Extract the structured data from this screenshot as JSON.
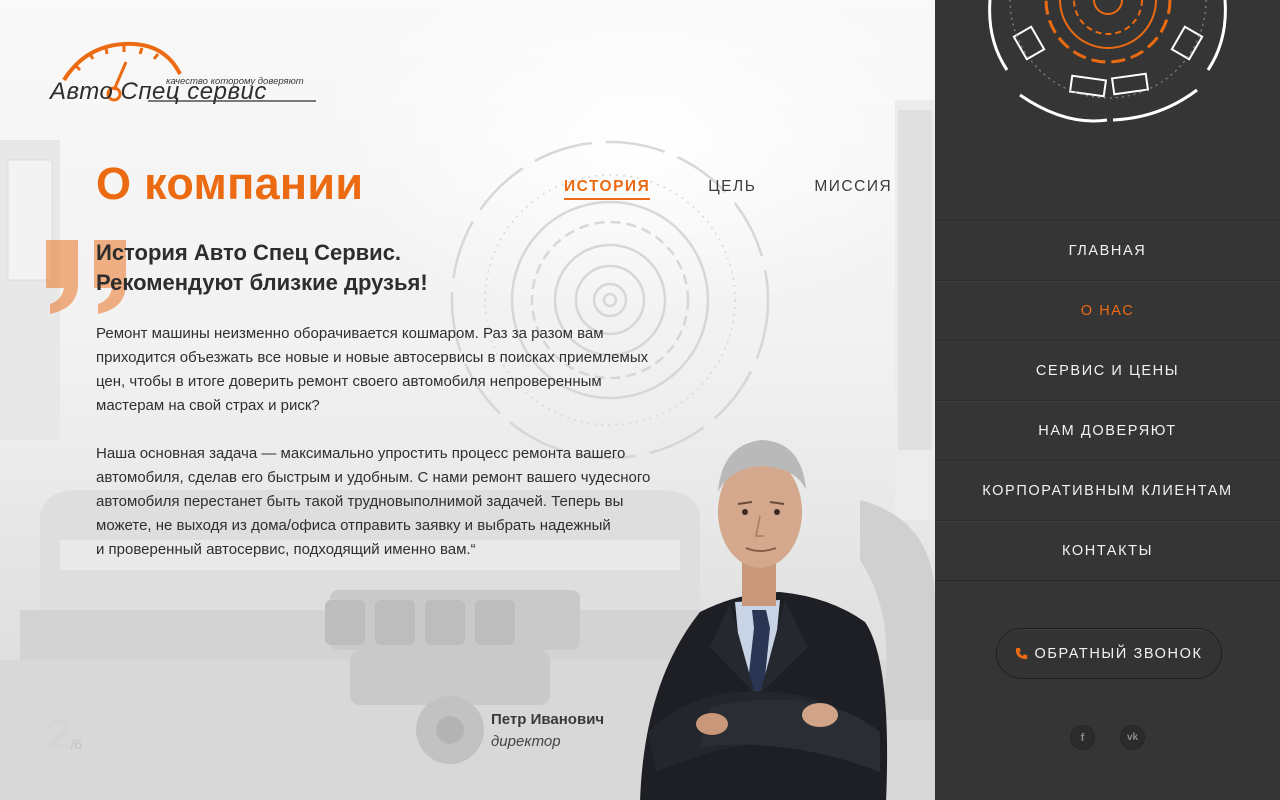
{
  "brand": {
    "title": "Авто Спец сервис",
    "slogan": "качество которому доверяют",
    "accent_color": "#ec6b12",
    "dark_color": "#353535"
  },
  "page": {
    "title": "О компании"
  },
  "tabs": [
    {
      "label": "История",
      "active": true
    },
    {
      "label": "Цель",
      "active": false
    },
    {
      "label": "Миссия",
      "active": false
    }
  ],
  "content": {
    "heading_line1": "История Авто Спец Сервис.",
    "heading_line2": "Рекомендуют близкие друзья!",
    "paragraph1": "Ремонт машины неизменно оборачивается кошмаром. Раз за разом вам\nприходится объезжать все новые и новые автосервисы в поисках приемлемых\nцен, чтобы в итоге доверить ремонт своего автомобиля непроверенным\nмастерам на свой страх и риск?",
    "paragraph2": "Наша основная задача — максимально упростить процесс ремонта вашего\nавтомобиля, сделав его быстрым и удобным. С нами ремонт вашего чудесного\nавтомобиля перестанет быть такой трудновыполнимой задачей. Теперь вы\nможете, не выходя из дома/офиса отправить заявку и выбрать надежный\nи проверенный автосервис, подходящий именно вам.“"
  },
  "signature": {
    "name": "Петр Иванович",
    "role": "директор"
  },
  "pager": {
    "current": "2",
    "separator": "/",
    "total": "6"
  },
  "nav": [
    {
      "label": "Главная",
      "active": false,
      "name": "nav-item-home"
    },
    {
      "label": "О нас",
      "active": true,
      "name": "nav-item-about"
    },
    {
      "label": "Сервис и цены",
      "active": false,
      "name": "nav-item-services"
    },
    {
      "label": "Нам доверяют",
      "active": false,
      "name": "nav-item-trust"
    },
    {
      "label": "Корпоративным клиентам",
      "active": false,
      "name": "nav-item-corporate"
    },
    {
      "label": "Контакты",
      "active": false,
      "name": "nav-item-contacts"
    }
  ],
  "callback": {
    "label": "Обратный звонок",
    "icon": "phone-icon"
  },
  "social": [
    {
      "icon": "facebook-icon",
      "glyph": "f"
    },
    {
      "icon": "vk-icon",
      "glyph": "vk"
    }
  ]
}
